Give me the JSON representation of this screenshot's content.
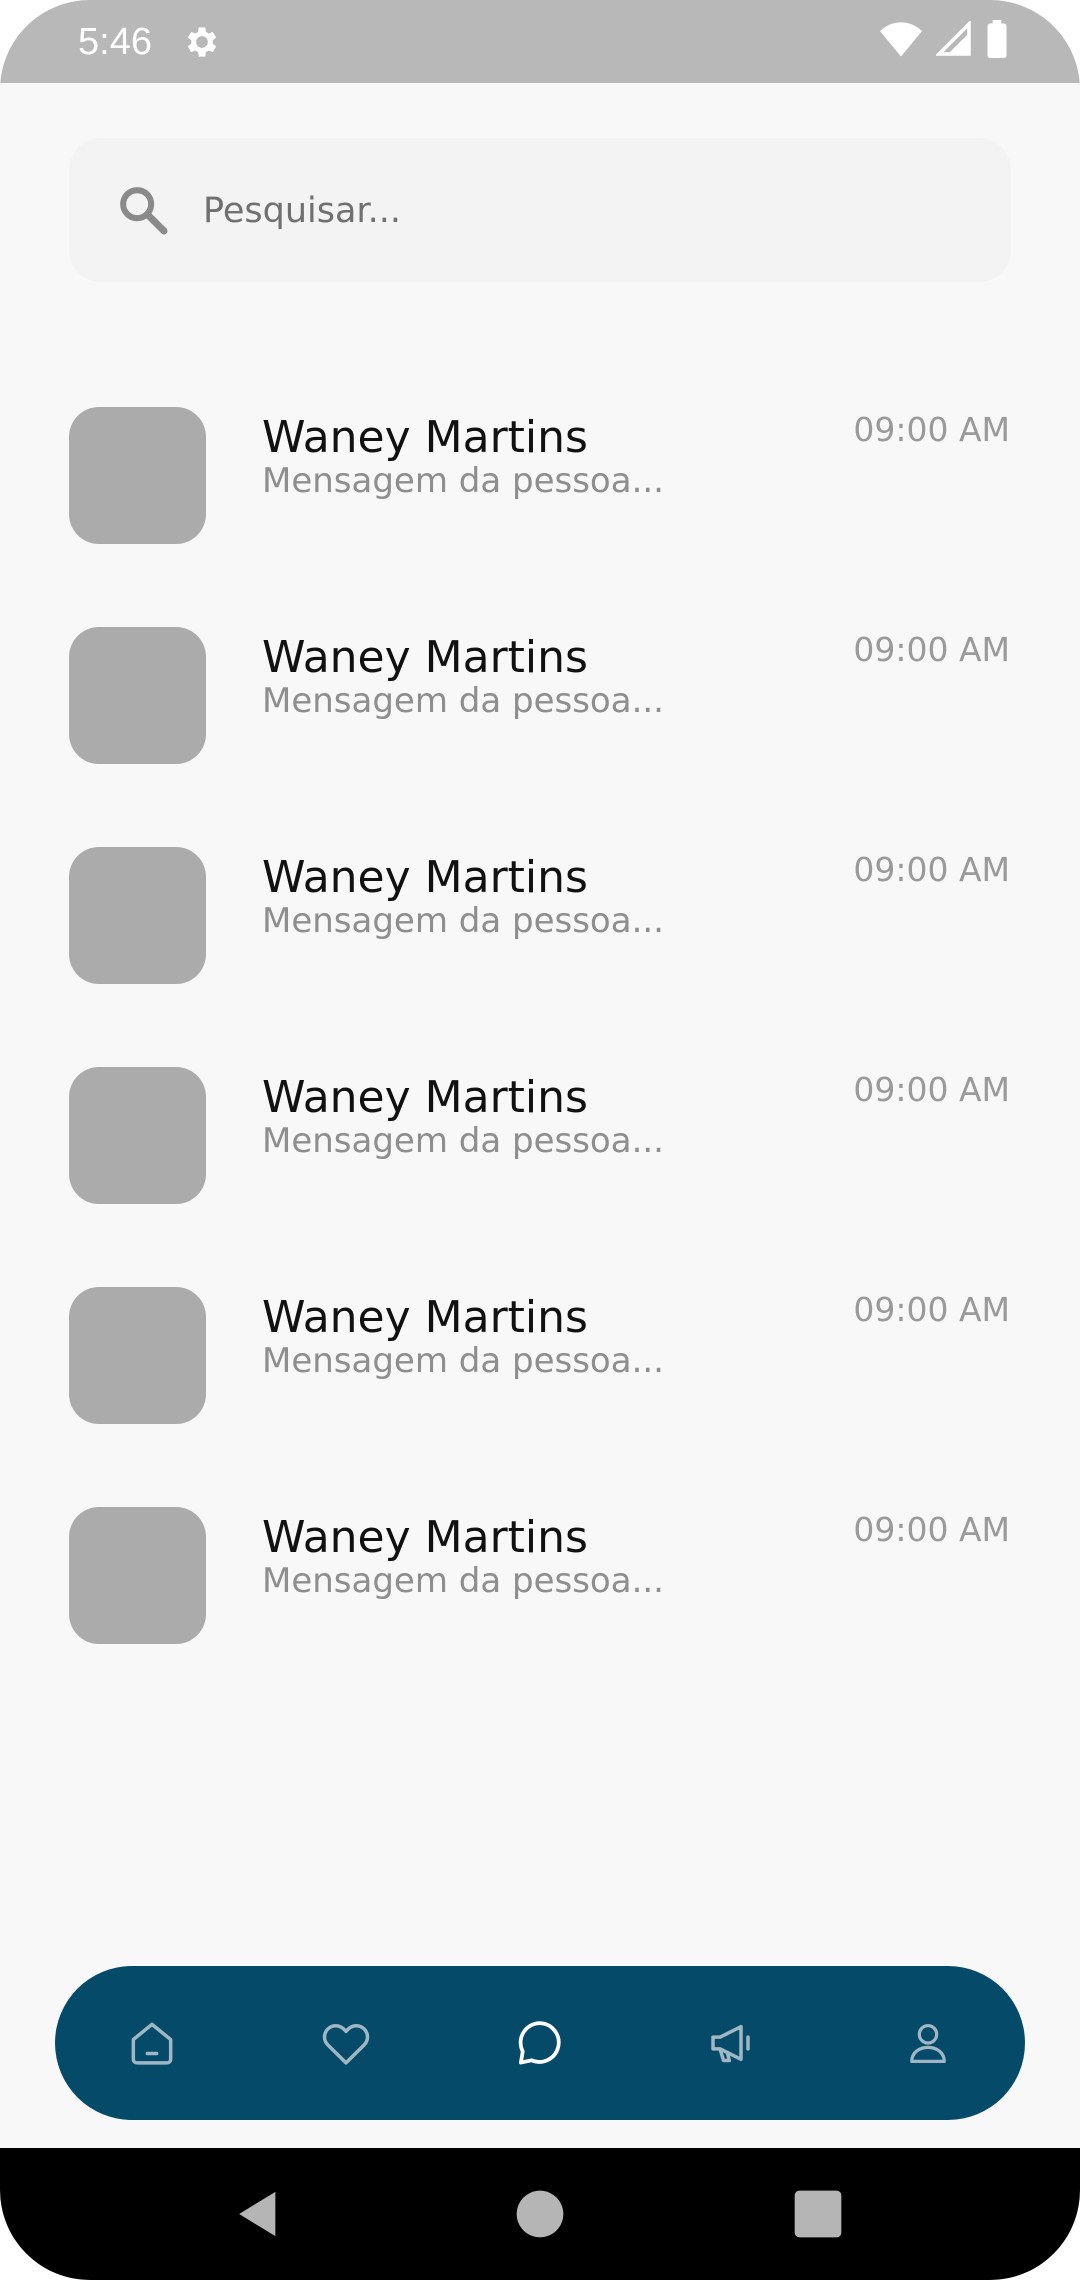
{
  "status_bar": {
    "time": "5:46"
  },
  "search": {
    "placeholder": "Pesquisar..."
  },
  "conversations": [
    {
      "name": "Waney Martins",
      "preview": "Mensagem da pessoa...",
      "time": "09:00 AM"
    },
    {
      "name": "Waney Martins",
      "preview": "Mensagem da pessoa...",
      "time": "09:00 AM"
    },
    {
      "name": "Waney Martins",
      "preview": "Mensagem da pessoa...",
      "time": "09:00 AM"
    },
    {
      "name": "Waney Martins",
      "preview": "Mensagem da pessoa...",
      "time": "09:00 AM"
    },
    {
      "name": "Waney Martins",
      "preview": "Mensagem da pessoa...",
      "time": "09:00 AM"
    },
    {
      "name": "Waney Martins",
      "preview": "Mensagem da pessoa...",
      "time": "09:00 AM"
    }
  ],
  "bottom_nav": {
    "items": [
      "home-icon",
      "heart-icon",
      "chat-icon",
      "megaphone-icon",
      "profile-icon"
    ],
    "active": "chat-icon"
  },
  "colors": {
    "nav_bg": "#064a6a",
    "avatar": "#ababab",
    "status_bar": "#b8b8b8"
  }
}
